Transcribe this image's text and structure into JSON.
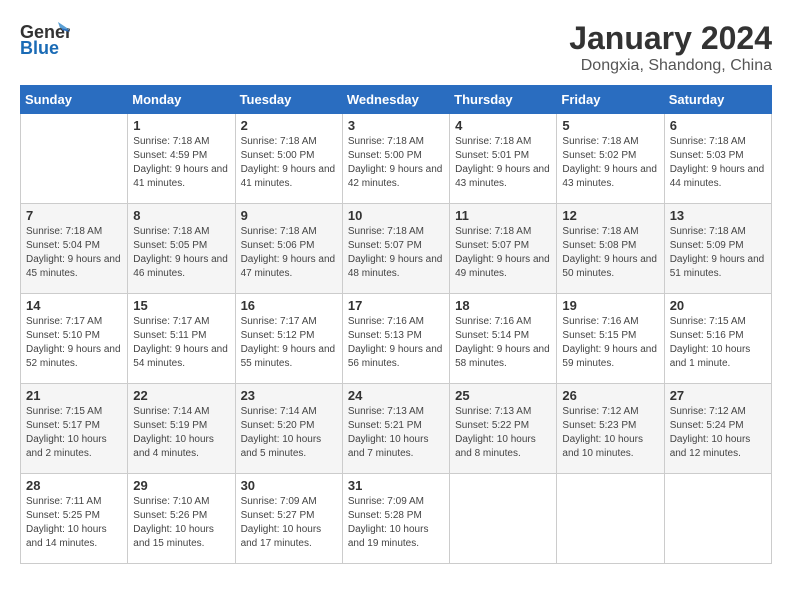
{
  "header": {
    "logo_general": "General",
    "logo_blue": "Blue",
    "month_title": "January 2024",
    "location": "Dongxia, Shandong, China"
  },
  "weekdays": [
    "Sunday",
    "Monday",
    "Tuesday",
    "Wednesday",
    "Thursday",
    "Friday",
    "Saturday"
  ],
  "weeks": [
    [
      {
        "day": "",
        "sunrise": "",
        "sunset": "",
        "daylight": ""
      },
      {
        "day": "1",
        "sunrise": "Sunrise: 7:18 AM",
        "sunset": "Sunset: 4:59 PM",
        "daylight": "Daylight: 9 hours and 41 minutes."
      },
      {
        "day": "2",
        "sunrise": "Sunrise: 7:18 AM",
        "sunset": "Sunset: 5:00 PM",
        "daylight": "Daylight: 9 hours and 41 minutes."
      },
      {
        "day": "3",
        "sunrise": "Sunrise: 7:18 AM",
        "sunset": "Sunset: 5:00 PM",
        "daylight": "Daylight: 9 hours and 42 minutes."
      },
      {
        "day": "4",
        "sunrise": "Sunrise: 7:18 AM",
        "sunset": "Sunset: 5:01 PM",
        "daylight": "Daylight: 9 hours and 43 minutes."
      },
      {
        "day": "5",
        "sunrise": "Sunrise: 7:18 AM",
        "sunset": "Sunset: 5:02 PM",
        "daylight": "Daylight: 9 hours and 43 minutes."
      },
      {
        "day": "6",
        "sunrise": "Sunrise: 7:18 AM",
        "sunset": "Sunset: 5:03 PM",
        "daylight": "Daylight: 9 hours and 44 minutes."
      }
    ],
    [
      {
        "day": "7",
        "sunrise": "Sunrise: 7:18 AM",
        "sunset": "Sunset: 5:04 PM",
        "daylight": "Daylight: 9 hours and 45 minutes."
      },
      {
        "day": "8",
        "sunrise": "Sunrise: 7:18 AM",
        "sunset": "Sunset: 5:05 PM",
        "daylight": "Daylight: 9 hours and 46 minutes."
      },
      {
        "day": "9",
        "sunrise": "Sunrise: 7:18 AM",
        "sunset": "Sunset: 5:06 PM",
        "daylight": "Daylight: 9 hours and 47 minutes."
      },
      {
        "day": "10",
        "sunrise": "Sunrise: 7:18 AM",
        "sunset": "Sunset: 5:07 PM",
        "daylight": "Daylight: 9 hours and 48 minutes."
      },
      {
        "day": "11",
        "sunrise": "Sunrise: 7:18 AM",
        "sunset": "Sunset: 5:07 PM",
        "daylight": "Daylight: 9 hours and 49 minutes."
      },
      {
        "day": "12",
        "sunrise": "Sunrise: 7:18 AM",
        "sunset": "Sunset: 5:08 PM",
        "daylight": "Daylight: 9 hours and 50 minutes."
      },
      {
        "day": "13",
        "sunrise": "Sunrise: 7:18 AM",
        "sunset": "Sunset: 5:09 PM",
        "daylight": "Daylight: 9 hours and 51 minutes."
      }
    ],
    [
      {
        "day": "14",
        "sunrise": "Sunrise: 7:17 AM",
        "sunset": "Sunset: 5:10 PM",
        "daylight": "Daylight: 9 hours and 52 minutes."
      },
      {
        "day": "15",
        "sunrise": "Sunrise: 7:17 AM",
        "sunset": "Sunset: 5:11 PM",
        "daylight": "Daylight: 9 hours and 54 minutes."
      },
      {
        "day": "16",
        "sunrise": "Sunrise: 7:17 AM",
        "sunset": "Sunset: 5:12 PM",
        "daylight": "Daylight: 9 hours and 55 minutes."
      },
      {
        "day": "17",
        "sunrise": "Sunrise: 7:16 AM",
        "sunset": "Sunset: 5:13 PM",
        "daylight": "Daylight: 9 hours and 56 minutes."
      },
      {
        "day": "18",
        "sunrise": "Sunrise: 7:16 AM",
        "sunset": "Sunset: 5:14 PM",
        "daylight": "Daylight: 9 hours and 58 minutes."
      },
      {
        "day": "19",
        "sunrise": "Sunrise: 7:16 AM",
        "sunset": "Sunset: 5:15 PM",
        "daylight": "Daylight: 9 hours and 59 minutes."
      },
      {
        "day": "20",
        "sunrise": "Sunrise: 7:15 AM",
        "sunset": "Sunset: 5:16 PM",
        "daylight": "Daylight: 10 hours and 1 minute."
      }
    ],
    [
      {
        "day": "21",
        "sunrise": "Sunrise: 7:15 AM",
        "sunset": "Sunset: 5:17 PM",
        "daylight": "Daylight: 10 hours and 2 minutes."
      },
      {
        "day": "22",
        "sunrise": "Sunrise: 7:14 AM",
        "sunset": "Sunset: 5:19 PM",
        "daylight": "Daylight: 10 hours and 4 minutes."
      },
      {
        "day": "23",
        "sunrise": "Sunrise: 7:14 AM",
        "sunset": "Sunset: 5:20 PM",
        "daylight": "Daylight: 10 hours and 5 minutes."
      },
      {
        "day": "24",
        "sunrise": "Sunrise: 7:13 AM",
        "sunset": "Sunset: 5:21 PM",
        "daylight": "Daylight: 10 hours and 7 minutes."
      },
      {
        "day": "25",
        "sunrise": "Sunrise: 7:13 AM",
        "sunset": "Sunset: 5:22 PM",
        "daylight": "Daylight: 10 hours and 8 minutes."
      },
      {
        "day": "26",
        "sunrise": "Sunrise: 7:12 AM",
        "sunset": "Sunset: 5:23 PM",
        "daylight": "Daylight: 10 hours and 10 minutes."
      },
      {
        "day": "27",
        "sunrise": "Sunrise: 7:12 AM",
        "sunset": "Sunset: 5:24 PM",
        "daylight": "Daylight: 10 hours and 12 minutes."
      }
    ],
    [
      {
        "day": "28",
        "sunrise": "Sunrise: 7:11 AM",
        "sunset": "Sunset: 5:25 PM",
        "daylight": "Daylight: 10 hours and 14 minutes."
      },
      {
        "day": "29",
        "sunrise": "Sunrise: 7:10 AM",
        "sunset": "Sunset: 5:26 PM",
        "daylight": "Daylight: 10 hours and 15 minutes."
      },
      {
        "day": "30",
        "sunrise": "Sunrise: 7:09 AM",
        "sunset": "Sunset: 5:27 PM",
        "daylight": "Daylight: 10 hours and 17 minutes."
      },
      {
        "day": "31",
        "sunrise": "Sunrise: 7:09 AM",
        "sunset": "Sunset: 5:28 PM",
        "daylight": "Daylight: 10 hours and 19 minutes."
      },
      {
        "day": "",
        "sunrise": "",
        "sunset": "",
        "daylight": ""
      },
      {
        "day": "",
        "sunrise": "",
        "sunset": "",
        "daylight": ""
      },
      {
        "day": "",
        "sunrise": "",
        "sunset": "",
        "daylight": ""
      }
    ]
  ]
}
